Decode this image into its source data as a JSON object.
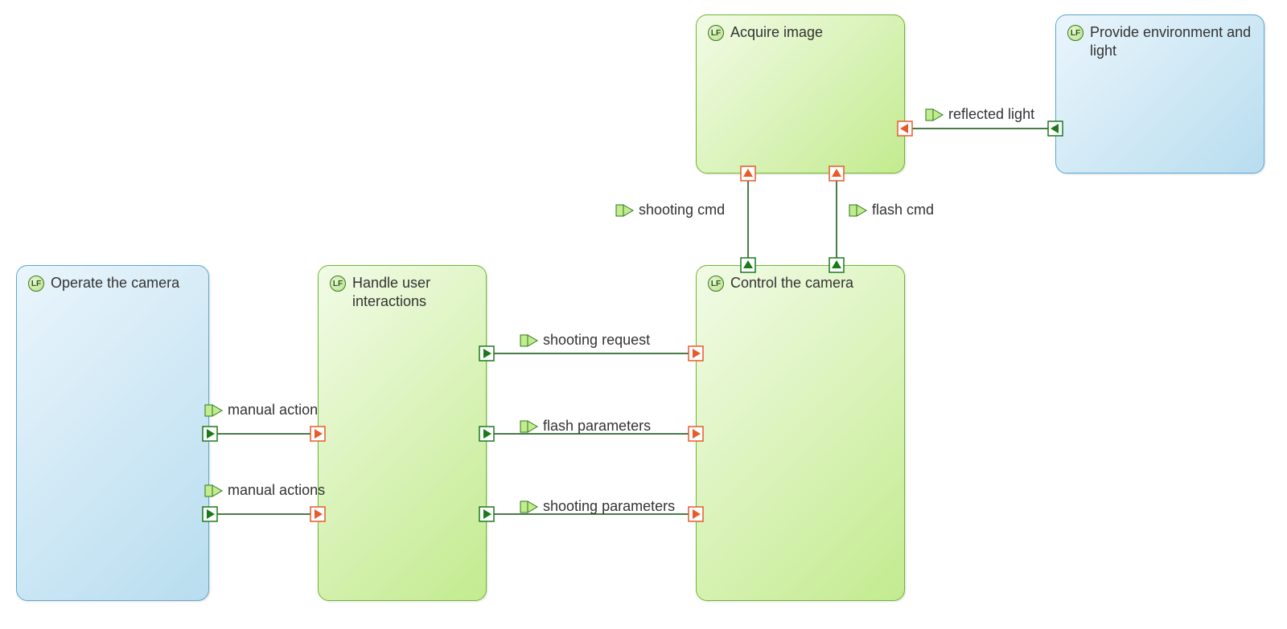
{
  "blocks": {
    "operate": {
      "label": "Operate the camera",
      "badge": "LF"
    },
    "handle": {
      "label": "Handle user interactions",
      "badge": "LF"
    },
    "control": {
      "label": "Control the camera",
      "badge": "LF"
    },
    "acquire": {
      "label": "Acquire image",
      "badge": "LF"
    },
    "provide": {
      "label": "Provide environment and light",
      "badge": "LF"
    }
  },
  "flows": {
    "manual_action": "manual action",
    "manual_actions": "manual actions",
    "shooting_request": "shooting request",
    "flash_parameters": "flash parameters",
    "shooting_parameters": "shooting parameters",
    "shooting_cmd": "shooting cmd",
    "flash_cmd": "flash cmd",
    "reflected_light": "reflected light"
  },
  "colors": {
    "green_border": "#6fb92e",
    "blue_border": "#5ca9d6",
    "connector": "#0e4f0e",
    "port_out_fill": "#1a7a1a",
    "port_in_fill": "#e85a2a",
    "port_stroke": "#ffffff"
  }
}
